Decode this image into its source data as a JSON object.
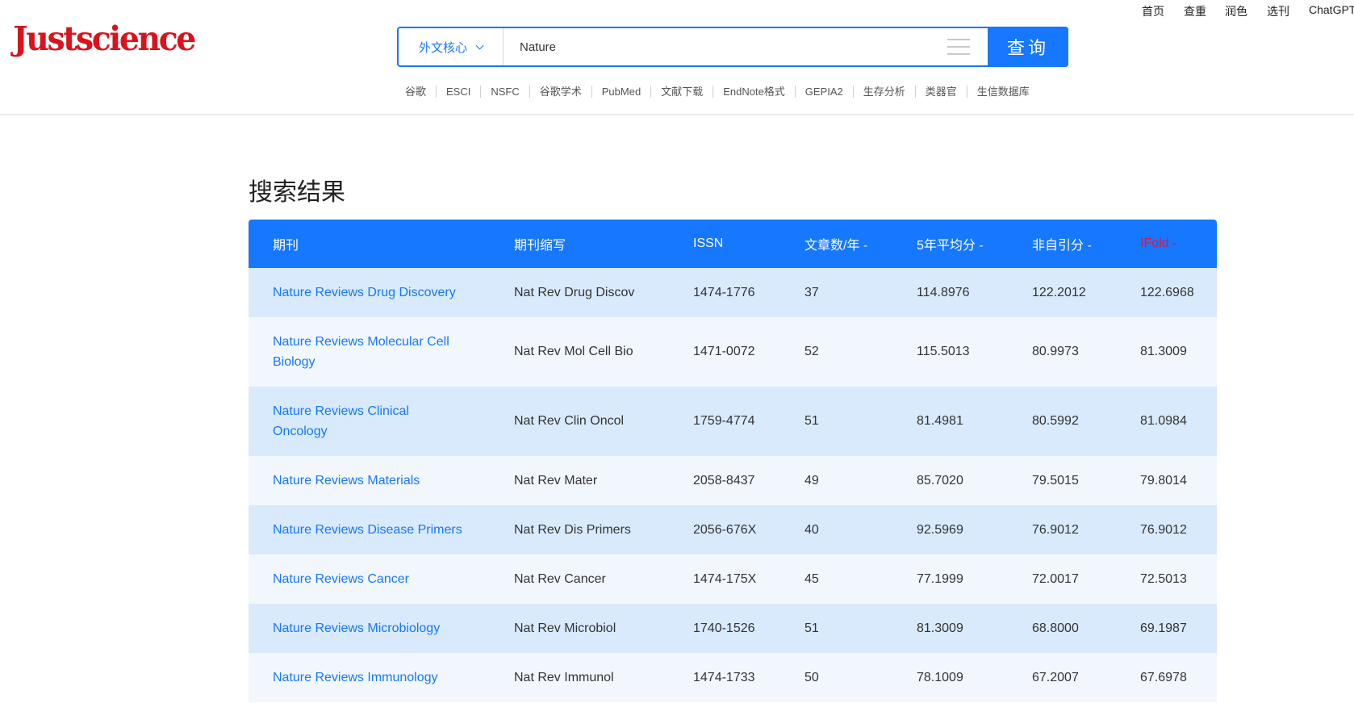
{
  "logo": "Justscience",
  "topnav": [
    "首页",
    "查重",
    "润色",
    "选刊",
    "ChatGPT"
  ],
  "search": {
    "type_label": "外文核心",
    "query": "Nature",
    "button_label": "查询"
  },
  "quicklinks": [
    "谷歌",
    "ESCI",
    "NSFC",
    "谷歌学术",
    "PubMed",
    "文献下载",
    "EndNote格式",
    "GEPIA2",
    "生存分析",
    "类器官",
    "生信数据库"
  ],
  "results": {
    "title": "搜索结果",
    "columns": [
      "期刊",
      "期刊缩写",
      "ISSN",
      "文章数/年 -",
      "5年平均分 -",
      "非自引分 -",
      "IFold -"
    ],
    "rows": [
      {
        "journal": "Nature Reviews Drug Discovery",
        "abbr": "Nat Rev Drug Discov",
        "issn": "1474-1776",
        "articles": "37",
        "avg5": "114.8976",
        "nonself": "122.2012",
        "ifold": "122.6968"
      },
      {
        "journal": "Nature Reviews Molecular Cell Biology",
        "abbr": "Nat Rev Mol Cell Bio",
        "issn": "1471-0072",
        "articles": "52",
        "avg5": "115.5013",
        "nonself": "80.9973",
        "ifold": "81.3009"
      },
      {
        "journal": "Nature Reviews Clinical Oncology",
        "abbr": "Nat Rev Clin Oncol",
        "issn": "1759-4774",
        "articles": "51",
        "avg5": "81.4981",
        "nonself": "80.5992",
        "ifold": "81.0984"
      },
      {
        "journal": "Nature Reviews Materials",
        "abbr": "Nat Rev Mater",
        "issn": "2058-8437",
        "articles": "49",
        "avg5": "85.7020",
        "nonself": "79.5015",
        "ifold": "79.8014"
      },
      {
        "journal": "Nature Reviews Disease Primers",
        "abbr": "Nat Rev Dis Primers",
        "issn": "2056-676X",
        "articles": "40",
        "avg5": "92.5969",
        "nonself": "76.9012",
        "ifold": "76.9012"
      },
      {
        "journal": "Nature Reviews Cancer",
        "abbr": "Nat Rev Cancer",
        "issn": "1474-175X",
        "articles": "45",
        "avg5": "77.1999",
        "nonself": "72.0017",
        "ifold": "72.5013"
      },
      {
        "journal": "Nature Reviews Microbiology",
        "abbr": "Nat Rev Microbiol",
        "issn": "1740-1526",
        "articles": "51",
        "avg5": "81.3009",
        "nonself": "68.8000",
        "ifold": "69.1987"
      },
      {
        "journal": "Nature Reviews Immunology",
        "abbr": "Nat Rev Immunol",
        "issn": "1474-1733",
        "articles": "50",
        "avg5": "78.1009",
        "nonself": "67.2007",
        "ifold": "67.6978"
      }
    ]
  }
}
